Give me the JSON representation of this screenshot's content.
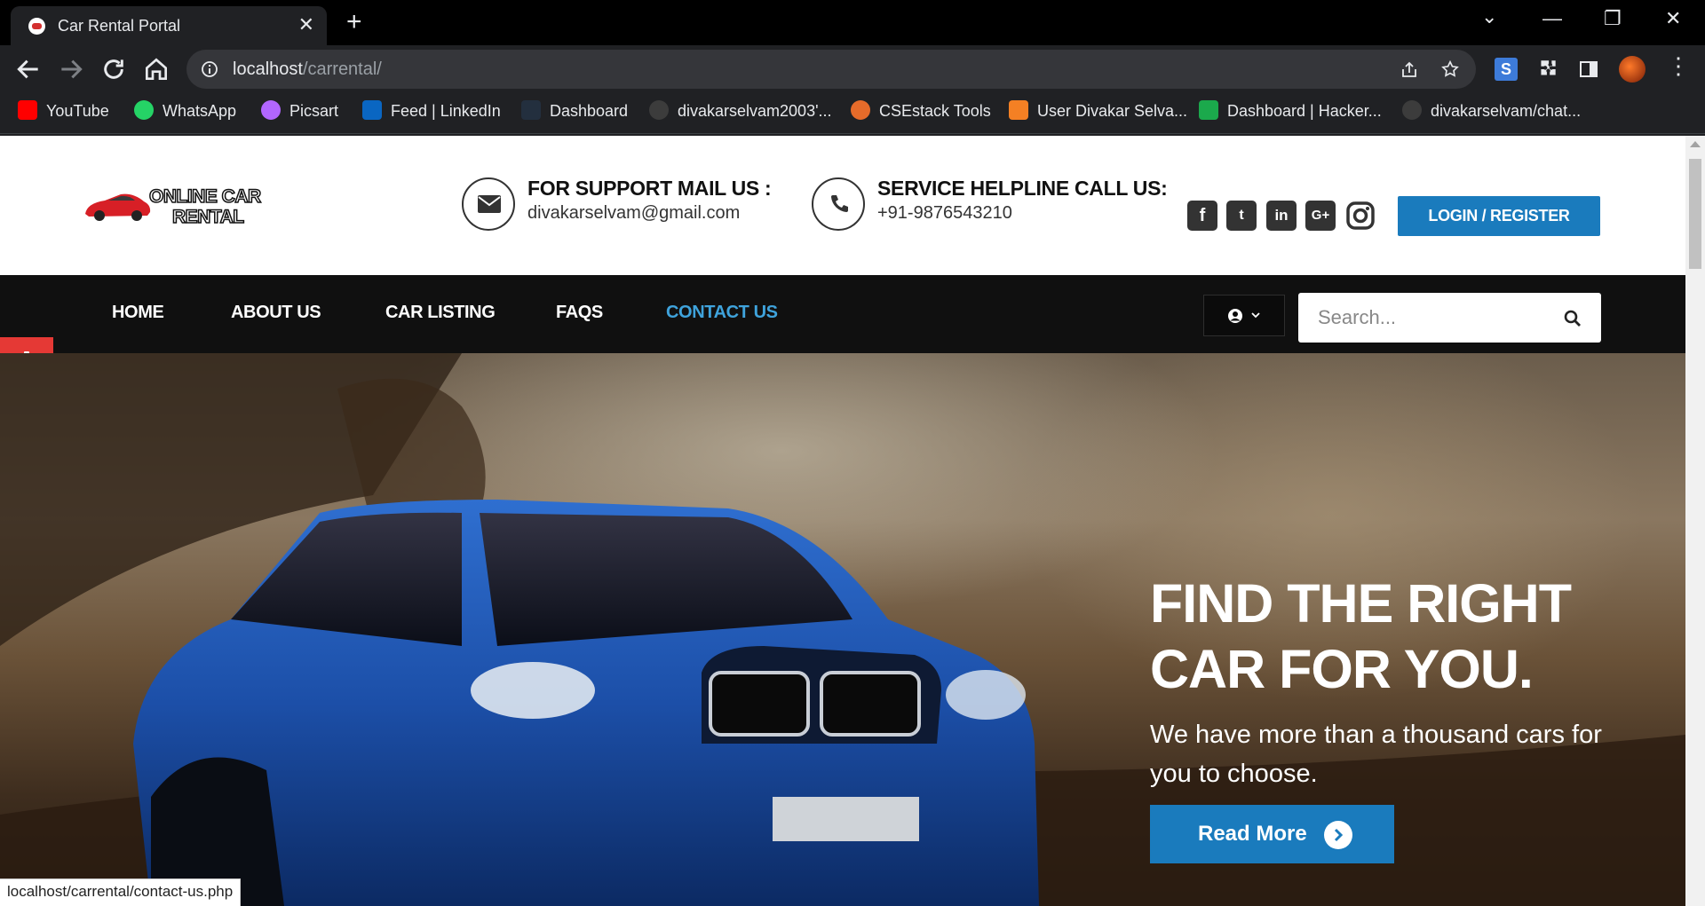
{
  "browser": {
    "tab_title": "Car Rental Portal",
    "url_host": "localhost",
    "url_path": "/carrental/",
    "status_url": "localhost/carrental/contact-us.php",
    "bookmarks": [
      {
        "label": "YouTube",
        "icon": "youtube-icon",
        "color": "#ff0000"
      },
      {
        "label": "WhatsApp",
        "icon": "whatsapp-icon",
        "color": "#25d366"
      },
      {
        "label": "Picsart",
        "icon": "picsart-icon",
        "color": "#b266ff"
      },
      {
        "label": "Feed | LinkedIn",
        "icon": "linkedin-icon",
        "color": "#0a66c2"
      },
      {
        "label": "Dashboard",
        "icon": "aws-icon",
        "color": "#232f3e"
      },
      {
        "label": "divakarselvam2003'...",
        "icon": "github-icon",
        "color": "#3c3c3c"
      },
      {
        "label": "CSEstack Tools",
        "icon": "csestack-icon",
        "color": "#e66b2a"
      },
      {
        "label": "User Divakar Selva...",
        "icon": "stackoverflow-icon",
        "color": "#f48024"
      },
      {
        "label": "Dashboard | Hacker...",
        "icon": "hackerrank-icon",
        "color": "#1ba94c"
      },
      {
        "label": "divakarselvam/chat...",
        "icon": "github-icon",
        "color": "#3c3c3c"
      }
    ]
  },
  "header": {
    "logo_line1": "ONLINE CAR",
    "logo_line2": "RENTAL",
    "support_title": "FOR SUPPORT MAIL US :",
    "support_email": "divakarselvam@gmail.com",
    "helpline_title": "SERVICE HELPLINE CALL US:",
    "helpline_phone": "+91-9876543210",
    "login_label": "LOGIN / REGISTER"
  },
  "nav": {
    "items": [
      {
        "label": "HOME"
      },
      {
        "label": "ABOUT US"
      },
      {
        "label": "CAR LISTING"
      },
      {
        "label": "FAQS"
      },
      {
        "label": "CONTACT US",
        "active": true
      }
    ],
    "search_placeholder": "Search..."
  },
  "hero": {
    "title_line1": "FIND THE RIGHT",
    "title_line2": "CAR FOR YOU.",
    "subtitle": "We have more than a thousand cars for you to choose.",
    "button_label": "Read More"
  },
  "colors": {
    "accent": "#1a7bbd",
    "nav_active": "#3fa3dc",
    "gear_tab": "#e53935"
  }
}
